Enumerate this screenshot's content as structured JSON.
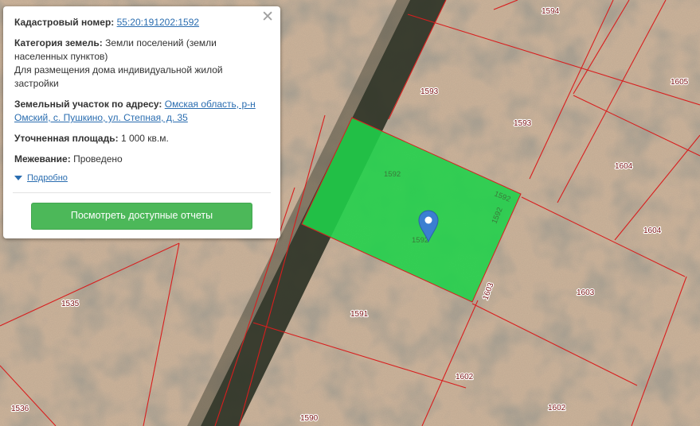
{
  "popup": {
    "cadastral_label": "Кадастровый номер:",
    "cadastral_number": "55:20:191202:1592",
    "category_label": "Категория земель:",
    "category_value": "Земли поселений (земли населенных пунктов)",
    "usage_value": "Для размещения дома индивидуальной жилой застройки",
    "address_label": "Земельный участок по адресу:",
    "address_value": "Омская область, р-н Омский, с. Пушкино, ул. Степная, д. 35",
    "area_label": "Уточненная площадь:",
    "area_value": "1 000 кв.м.",
    "survey_label": "Межевание:",
    "survey_value": "Проведено",
    "more_link": "Подробно",
    "report_button": "Посмотреть доступные отчеты"
  },
  "map": {
    "parcel_labels": [
      "1594",
      "1605",
      "1593",
      "1593",
      "1592",
      "1592",
      "1592",
      "1604",
      "1604",
      "1592",
      "1603",
      "1603",
      "1591",
      "1535",
      "1602",
      "1602",
      "1536",
      "1590"
    ],
    "highlight_color": "#1fd14a",
    "boundary_color": "#d81e1e",
    "marker_color": "#3b7fd1"
  }
}
